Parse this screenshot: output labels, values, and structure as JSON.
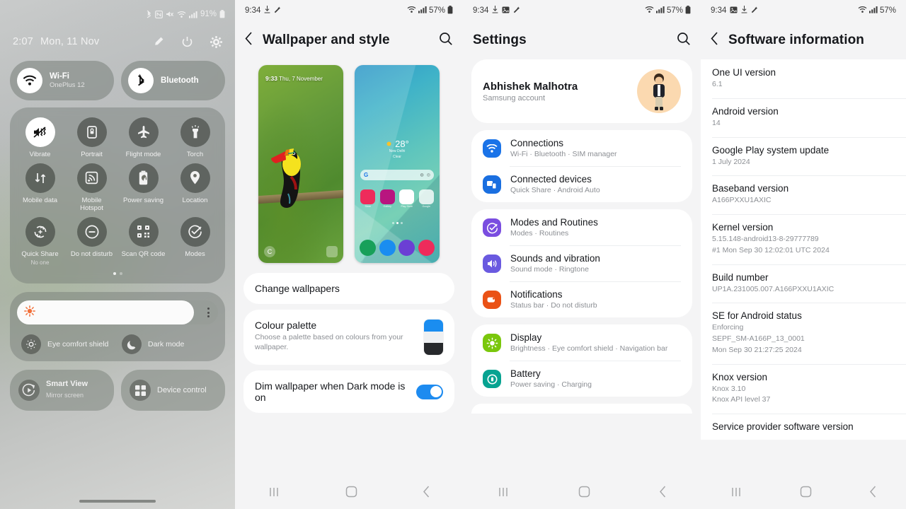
{
  "panel1": {
    "status": {
      "time_hidden": "",
      "battery": "91%",
      "icons": [
        "bluetooth-icon",
        "nfc-icon",
        "mute-icon",
        "wifi-icon",
        "signal-icon",
        "battery-icon"
      ]
    },
    "clock": "2:07",
    "date": "Mon, 11 Nov",
    "header_actions": [
      "pencil-icon",
      "power-icon",
      "gear-icon"
    ],
    "connections": [
      {
        "icon": "wifi-icon",
        "title": "Wi-Fi",
        "subtitle": "OnePlus 12"
      },
      {
        "icon": "bluetooth-icon",
        "title": "Bluetooth",
        "subtitle": ""
      }
    ],
    "tiles": [
      {
        "label": "Vibrate",
        "sub": "",
        "icon": "vibrate-icon",
        "on": true
      },
      {
        "label": "Portrait",
        "sub": "",
        "icon": "rotation-lock-icon",
        "on": false
      },
      {
        "label": "Flight mode",
        "sub": "",
        "icon": "airplane-icon",
        "on": false
      },
      {
        "label": "Torch",
        "sub": "",
        "icon": "flashlight-icon",
        "on": false
      },
      {
        "label": "Mobile data",
        "sub": "",
        "icon": "mobile-data-icon",
        "on": false
      },
      {
        "label": "Mobile Hotspot",
        "sub": "",
        "icon": "hotspot-icon",
        "on": false
      },
      {
        "label": "Power saving",
        "sub": "",
        "icon": "power-saving-icon",
        "on": false
      },
      {
        "label": "Location",
        "sub": "",
        "icon": "location-pin-icon",
        "on": false
      },
      {
        "label": "Quick Share",
        "sub": "No one",
        "icon": "quick-share-icon",
        "on": false
      },
      {
        "label": "Do not disturb",
        "sub": "",
        "icon": "do-not-disturb-icon",
        "on": false
      },
      {
        "label": "Scan QR code",
        "sub": "",
        "icon": "qr-code-icon",
        "on": false
      },
      {
        "label": "Modes",
        "sub": "",
        "icon": "modes-check-icon",
        "on": false
      }
    ],
    "brightness": {
      "percent": 88,
      "icon": "brightness-sun-icon",
      "menu_icon": "more-vertical-icon"
    },
    "display_toggles": [
      {
        "label": "Eye comfort shield",
        "icon": "eye-comfort-icon"
      },
      {
        "label": "Dark mode",
        "icon": "moon-icon"
      }
    ],
    "bottom_buttons": [
      {
        "title": "Smart View",
        "subtitle": "Mirror screen",
        "icon": "smart-view-icon"
      },
      {
        "title": "Device control",
        "subtitle": "",
        "icon": "device-control-icon"
      }
    ]
  },
  "panel2": {
    "status": {
      "time": "9:34",
      "battery": "57%",
      "left_icons": [
        "download-icon",
        "magic-wand-icon"
      ],
      "right_icons": [
        "wifi-icon",
        "signal-icon",
        "battery-icon"
      ]
    },
    "title": "Wallpaper and style",
    "back_icon": "chevron-left-icon",
    "search_icon": "search-icon",
    "preview_lock": {
      "time": "9:33",
      "date": "Thu, 7 November",
      "left_icon": "phone-icon",
      "right_icon": "camera-icon"
    },
    "preview_home": {
      "temp": "28°",
      "city": "New Delhi",
      "condition": "Clear",
      "search_placeholder": "",
      "google_letter": "G",
      "apps": [
        "Store",
        "Gallery",
        "Play Store",
        "Google"
      ]
    },
    "rows": [
      {
        "title": "Change wallpapers",
        "sub": ""
      },
      {
        "title": "Colour palette",
        "sub": "Choose a palette based on colours from your wallpaper."
      },
      {
        "title": "Dim wallpaper when Dark mode is on",
        "sub": ""
      }
    ],
    "swatch_colors": [
      "#1a8df0",
      "#eef0f2",
      "#27292c"
    ],
    "toggle_on": true,
    "nav_icons": [
      "recents-icon",
      "home-icon",
      "back-icon"
    ]
  },
  "panel3": {
    "status": {
      "time": "9:34",
      "battery": "57%",
      "left_icons": [
        "download-icon",
        "image-icon",
        "magic-wand-icon"
      ],
      "right_icons": [
        "wifi-icon",
        "signal-icon",
        "battery-icon"
      ]
    },
    "title": "Settings",
    "search_icon": "search-icon",
    "account": {
      "name": "Abhishek Malhotra",
      "subtitle": "Samsung account",
      "avatar": "avatar-emoji"
    },
    "groups": [
      [
        {
          "title": "Connections",
          "subtitle": "Wi-Fi  ·  Bluetooth  ·  SIM manager",
          "icon": "wifi-icon",
          "color": "#1a73e8"
        },
        {
          "title": "Connected devices",
          "subtitle": "Quick Share  ·  Android Auto",
          "icon": "connected-devices-icon",
          "color": "#1a6fe0"
        }
      ],
      [
        {
          "title": "Modes and Routines",
          "subtitle": "Modes  ·  Routines",
          "icon": "modes-check-icon",
          "color": "#7a4de0"
        },
        {
          "title": "Sounds and vibration",
          "subtitle": "Sound mode  ·  Ringtone",
          "icon": "speaker-icon",
          "color": "#6a5ae0"
        },
        {
          "title": "Notifications",
          "subtitle": "Status bar  ·  Do not disturb",
          "icon": "notifications-icon",
          "color": "#ea5216"
        }
      ],
      [
        {
          "title": "Display",
          "subtitle": "Brightness  ·  Eye comfort shield  ·  Navigation bar",
          "icon": "brightness-sun-icon",
          "color": "#7ac70c"
        },
        {
          "title": "Battery",
          "subtitle": "Power saving  ·  Charging",
          "icon": "battery-circle-icon",
          "color": "#07a391"
        }
      ]
    ],
    "nav_icons": [
      "recents-icon",
      "home-icon",
      "back-icon"
    ]
  },
  "panel4": {
    "status": {
      "time": "9:34",
      "battery": "57%",
      "left_icons": [
        "image-icon",
        "download-icon",
        "magic-wand-icon"
      ],
      "right_icons": [
        "wifi-icon",
        "signal-icon",
        "battery-icon"
      ]
    },
    "title": "Software information",
    "back_icon": "chevron-left-icon",
    "items": [
      {
        "key": "One UI version",
        "value": "6.1"
      },
      {
        "key": "Android version",
        "value": "14"
      },
      {
        "key": "Google Play system update",
        "value": "1 July 2024"
      },
      {
        "key": "Baseband version",
        "value": "A166PXXU1AXIC"
      },
      {
        "key": "Kernel version",
        "value": "5.15.148-android13-8-29777789\n#1 Mon Sep 30 12:02:01 UTC 2024"
      },
      {
        "key": "Build number",
        "value": "UP1A.231005.007.A166PXXU1AXIC"
      },
      {
        "key": "SE for Android status",
        "value": "Enforcing\nSEPF_SM-A166P_13_0001\nMon Sep 30 21:27:25 2024"
      },
      {
        "key": "Knox version",
        "value": "Knox 3.10\nKnox API level 37"
      },
      {
        "key": "Service provider software version",
        "value": ""
      }
    ],
    "nav_icons": [
      "recents-icon",
      "home-icon",
      "back-icon"
    ]
  }
}
